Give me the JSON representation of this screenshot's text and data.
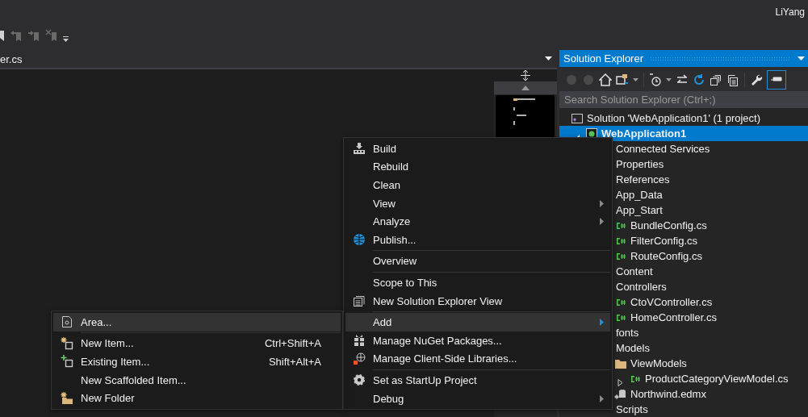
{
  "title_bar": {
    "user": "LiYang"
  },
  "editor": {
    "tab": "er.cs"
  },
  "solution_explorer": {
    "title": "Solution Explorer",
    "search": {
      "placeholder": "Search Solution Explorer (Ctrl+;)"
    },
    "tree": [
      {
        "label": "Solution 'WebApplication1' (1 project)",
        "kind": "solution",
        "selected": false,
        "children": [
          {
            "label": "WebApplication1",
            "kind": "project",
            "selected": true,
            "expanded": true,
            "children": [
              {
                "label": "Connected Services",
                "selected": false
              },
              {
                "label": "Properties",
                "selected": false
              },
              {
                "label": "References",
                "selected": false
              },
              {
                "label": "App_Data",
                "selected": false
              },
              {
                "label": "App_Start",
                "selected": false,
                "children": [
                  {
                    "label": "BundleConfig.cs",
                    "kind": "csharp",
                    "selected": false
                  },
                  {
                    "label": "FilterConfig.cs",
                    "kind": "csharp",
                    "selected": false
                  },
                  {
                    "label": "RouteConfig.cs",
                    "kind": "csharp",
                    "selected": false
                  }
                ]
              },
              {
                "label": "Content",
                "selected": false
              },
              {
                "label": "Controllers",
                "selected": false,
                "children": [
                  {
                    "label": "CtoVController.cs",
                    "kind": "csharp",
                    "selected": false
                  },
                  {
                    "label": "HomeController.cs",
                    "kind": "csharp",
                    "selected": false
                  }
                ]
              },
              {
                "label": "fonts",
                "selected": false
              },
              {
                "label": "Models",
                "selected": false,
                "children": [
                  {
                    "label": "ViewModels",
                    "kind": "folder",
                    "selected": false,
                    "children": [
                      {
                        "label": "ProductCategoryViewModel.cs",
                        "kind": "csharp",
                        "selected": false,
                        "expanded": false
                      }
                    ]
                  },
                  {
                    "label": "Northwind.edmx",
                    "kind": "edmx",
                    "selected": false
                  }
                ]
              },
              {
                "label": "Scripts",
                "selected": false
              }
            ]
          }
        ]
      }
    ]
  },
  "context_menu": {
    "groups": [
      [
        {
          "label": "Build",
          "submenu": false,
          "selected": false
        },
        {
          "label": "Rebuild",
          "submenu": false,
          "selected": false
        },
        {
          "label": "Clean",
          "submenu": false,
          "selected": false
        },
        {
          "label": "View",
          "submenu": true,
          "selected": false
        },
        {
          "label": "Analyze",
          "submenu": true,
          "selected": false
        },
        {
          "label": "Publish...",
          "submenu": false,
          "selected": false
        }
      ],
      [
        {
          "label": "Overview",
          "submenu": false,
          "selected": false
        }
      ],
      [
        {
          "label": "Scope to This",
          "submenu": false,
          "selected": false
        },
        {
          "label": "New Solution Explorer View",
          "submenu": false,
          "selected": false
        }
      ],
      [
        {
          "label": "Add",
          "submenu": true,
          "selected": true
        },
        {
          "label": "Manage NuGet Packages...",
          "submenu": false,
          "selected": false
        },
        {
          "label": "Manage Client-Side Libraries...",
          "submenu": false,
          "selected": false
        }
      ],
      [
        {
          "label": "Set as StartUp Project",
          "submenu": false,
          "selected": false
        },
        {
          "label": "Debug",
          "submenu": true,
          "selected": false
        }
      ]
    ]
  },
  "add_submenu": {
    "groups": [
      [
        {
          "label": "Area...",
          "submenu": false,
          "selected": true
        }
      ],
      [
        {
          "label": "New Item...",
          "shortcut": "Ctrl+Shift+A",
          "submenu": false,
          "selected": false
        },
        {
          "label": "Existing Item...",
          "shortcut": "Shift+Alt+A",
          "submenu": false,
          "selected": false
        },
        {
          "label": "New Scaffolded Item...",
          "submenu": false,
          "selected": false
        },
        {
          "label": "New Folder",
          "submenu": false,
          "selected": false
        }
      ]
    ]
  }
}
